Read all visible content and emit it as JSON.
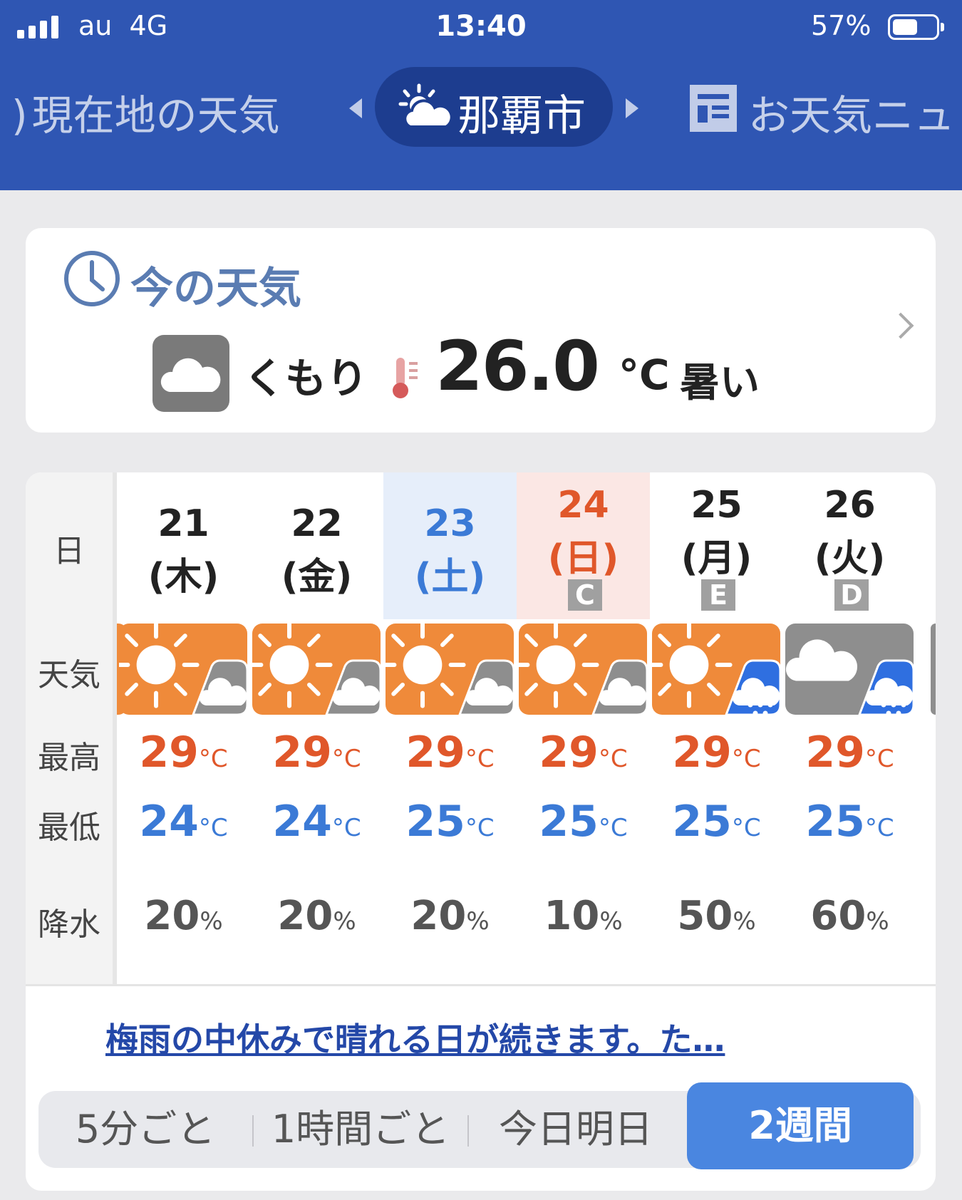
{
  "status_bar": {
    "carrier": "au",
    "network": "4G",
    "time": "13:40",
    "battery": "57%",
    "battery_level": 0.57
  },
  "nav": {
    "left_tab": "現在地の天気",
    "active_tab": "那覇市",
    "right_tab": "お天気ニュ",
    "icons": [
      "chevron-left-icon",
      "sun-cloud-icon",
      "chevron-right-icon",
      "news-icon"
    ]
  },
  "now": {
    "title": "今の天気",
    "condition": "くもり",
    "temp": "26.0",
    "unit": "°C",
    "feel": "暑い",
    "icons": [
      "clock-icon",
      "cloud-icon",
      "thermometer-icon"
    ]
  },
  "forecast": {
    "row_labels": {
      "day": "日",
      "weather": "天気",
      "high": "最高",
      "low": "最低",
      "precip": "降水"
    },
    "days": [
      {
        "date": "21",
        "weekday": "(木)",
        "badge": "",
        "weather": "sun-cloud",
        "high": "29",
        "low": "24",
        "precip": "20",
        "type": "weekday"
      },
      {
        "date": "22",
        "weekday": "(金)",
        "badge": "",
        "weather": "sun-cloud",
        "high": "29",
        "low": "24",
        "precip": "20",
        "type": "weekday"
      },
      {
        "date": "23",
        "weekday": "(土)",
        "badge": "",
        "weather": "sun-cloud",
        "high": "29",
        "low": "25",
        "precip": "20",
        "type": "saturday"
      },
      {
        "date": "24",
        "weekday": "(日)",
        "badge": "C",
        "weather": "sun-cloud",
        "high": "29",
        "low": "25",
        "precip": "10",
        "type": "sunday"
      },
      {
        "date": "25",
        "weekday": "(月)",
        "badge": "E",
        "weather": "sun-rain",
        "high": "29",
        "low": "25",
        "precip": "50",
        "type": "weekday"
      },
      {
        "date": "26",
        "weekday": "(火)",
        "badge": "D",
        "weather": "cloud-rain",
        "high": "29",
        "low": "25",
        "precip": "60",
        "type": "weekday"
      }
    ],
    "temp_unit": "°C",
    "precip_unit": "%",
    "colors": {
      "sunny": "#ef8a3a",
      "cloudy": "#8e8e8e",
      "rain": "#2f6fe0",
      "high": "#e0572a",
      "low": "#3b7ad6",
      "saturday_bg": "#e6eefa",
      "sunday_bg": "#fbe7e4",
      "saturday_text": "#3b7ad6",
      "sunday_text": "#e0572a"
    }
  },
  "news": {
    "headline": "梅雨の中休みで晴れる日が続きます。た…"
  },
  "segments": {
    "items": [
      "5分ごと",
      "1時間ごと",
      "今日明日"
    ],
    "active": "2週間"
  }
}
